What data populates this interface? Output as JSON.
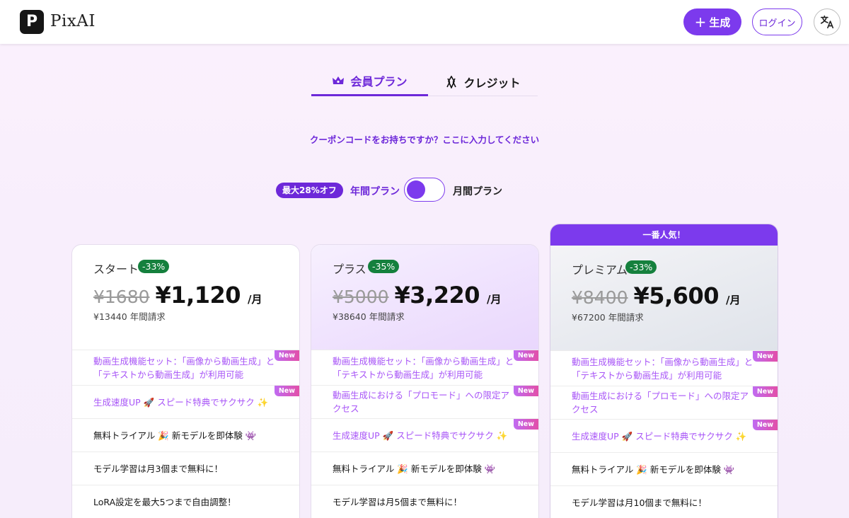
{
  "header": {
    "logo_letter": "P",
    "app_name": "PixAI",
    "generate_label": "生成",
    "login_label": "ログイン",
    "translate_icon": "translate-icon"
  },
  "tabs": [
    {
      "label": "会員プラン",
      "icon": "crown-icon",
      "active": true
    },
    {
      "label": "クレジット",
      "icon": "coins-icon",
      "active": false
    }
  ],
  "coupon_text": "クーポンコードをお持ちですか？ここに入力してください",
  "billing": {
    "discount_badge": "最大28%オフ",
    "annual_label": "年間プラン",
    "monthly_label": "月間プラン",
    "selected": "annual"
  },
  "colors": {
    "accent": "#7c3aed",
    "discount_green": "#15803d",
    "feature_purple": "#a855f7"
  },
  "plans": [
    {
      "name": "スタート",
      "discount": "-33%",
      "old_price": "¥1680",
      "price": "¥1,120",
      "per": "/月",
      "annual_bill": "¥13440 年間請求",
      "features": [
        {
          "text": "動画生成機能セット：「画像から動画生成」と「テキストから動画生成」が利用可能",
          "new": "New",
          "highlight": true
        },
        {
          "text": "生成速度UP 🚀 スピード特典でサクサク ✨",
          "new": "New",
          "highlight": true
        },
        {
          "text": "無料トライアル 🎉 新モデルを即体験 👾",
          "new": "",
          "highlight": false
        },
        {
          "text": "モデル学習は月3個まで無料に！",
          "new": "",
          "highlight": false
        },
        {
          "text": "LoRA設定を最大5つまで自由調整！",
          "new": "",
          "highlight": false
        }
      ]
    },
    {
      "name": "プラス",
      "discount": "-35%",
      "old_price": "¥5000",
      "price": "¥3,220",
      "per": "/月",
      "annual_bill": "¥38640 年間請求",
      "features": [
        {
          "text": "動画生成機能セット：「画像から動画生成」と「テキストから動画生成」が利用可能",
          "new": "New",
          "highlight": true
        },
        {
          "text": "動画生成における「プロモード」への限定アクセス",
          "new": "New",
          "highlight": true
        },
        {
          "text": "生成速度UP 🚀 スピード特典でサクサク ✨",
          "new": "New",
          "highlight": true
        },
        {
          "text": "無料トライアル 🎉 新モデルを即体験 👾",
          "new": "",
          "highlight": false
        },
        {
          "text": "モデル学習は月5個まで無料に！",
          "new": "",
          "highlight": false
        }
      ]
    },
    {
      "popular": "一番人気！",
      "name": "プレミアム",
      "discount": "-33%",
      "old_price": "¥8400",
      "price": "¥5,600",
      "per": "/月",
      "annual_bill": "¥67200 年間請求",
      "features": [
        {
          "text": "動画生成機能セット：「画像から動画生成」と「テキストから動画生成」が利用可能",
          "new": "New",
          "highlight": true
        },
        {
          "text": "動画生成における「プロモード」への限定アクセス",
          "new": "New",
          "highlight": true
        },
        {
          "text": "生成速度UP 🚀 スピード特典でサクサク ✨",
          "new": "New",
          "highlight": true
        },
        {
          "text": "無料トライアル 🎉 新モデルを即体験 👾",
          "new": "",
          "highlight": false
        },
        {
          "text": "モデル学習は月10個まで無料に！",
          "new": "",
          "highlight": false
        }
      ]
    }
  ]
}
